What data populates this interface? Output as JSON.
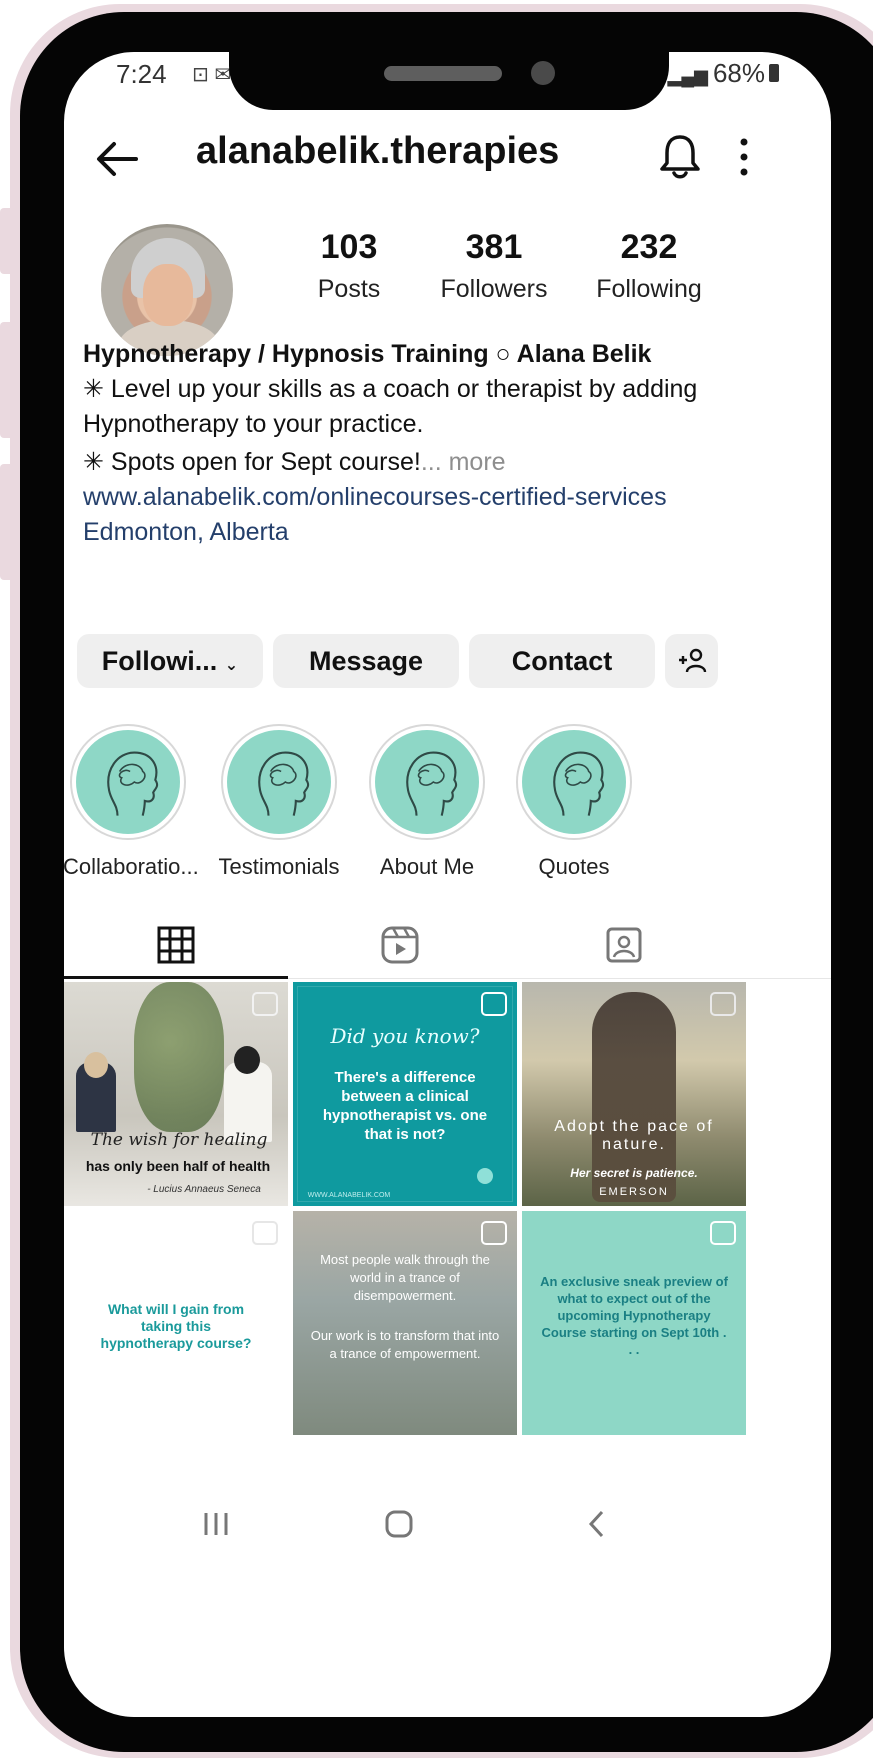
{
  "status_bar": {
    "time": "7:24",
    "left_icons": "⊡ ✉",
    "right_text": "68%"
  },
  "profile": {
    "username": "alanabelik.therapies",
    "stats": [
      {
        "value": "103",
        "label": "Posts"
      },
      {
        "value": "381",
        "label": "Followers"
      },
      {
        "value": "232",
        "label": "Following"
      }
    ],
    "bio": {
      "name_line": "Hypnotherapy / Hypnosis Training ○ Alana Belik",
      "line1": "✳ Level up your skills as a coach or therapist by adding Hypnotherapy to your practice.",
      "line2": "✳ Spots open for Sept course!",
      "more": "... more",
      "link": "www.alanabelik.com/onlinecourses-certified-services",
      "location": "Edmonton, Alberta"
    }
  },
  "actions": {
    "following": "Followi...",
    "message": "Message",
    "contact": "Contact",
    "add_user": "+"
  },
  "highlights": [
    {
      "label": "Collaboratio..."
    },
    {
      "label": "Testimonials"
    },
    {
      "label": "About Me"
    },
    {
      "label": "Quotes"
    }
  ],
  "posts": [
    {
      "script": "The wish for healing",
      "text": "has only been half of health",
      "sub": "- Lucius Annaeus Seneca"
    },
    {
      "script": "Did you know?",
      "text": "There's a difference between a clinical hypnotherapist vs. one that is not?",
      "sub": "WWW.ALANABELIK.COM"
    },
    {
      "text": "Adopt the pace of nature.",
      "sub": "Her secret is patience.",
      "author": "EMERSON"
    },
    {
      "text": "What will I gain from taking this hypnotherapy course?"
    },
    {
      "text": "Most people walk through the world in a trance of disempowerment.",
      "text2": "Our work is to transform that into a trance of empowerment."
    },
    {
      "text": "An exclusive sneak preview of what to expect out of the upcoming Hypnotherapy Course starting on Sept 10th . . ."
    }
  ],
  "colors": {
    "teal": "#0f9a9f",
    "mint": "#8ed7c6",
    "link": "#243f6b",
    "frame_pink": "#ead9df"
  }
}
